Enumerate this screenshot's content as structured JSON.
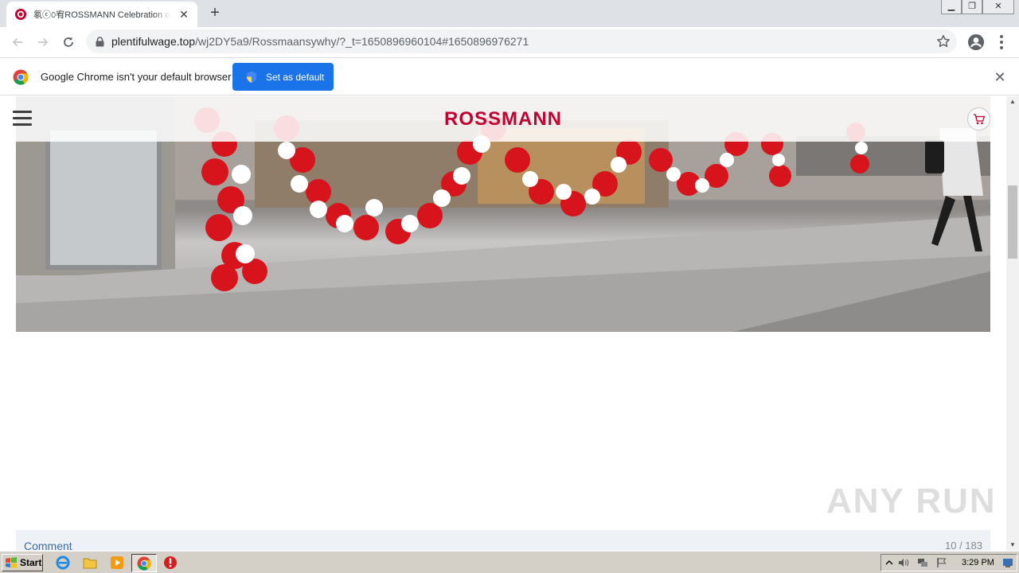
{
  "browser": {
    "tab": {
      "title": "氡ⓒ௦宥ROSSMANN Celebration of the"
    },
    "address": {
      "host": "plentifulwage.top",
      "path": "/wj2DY5a9/Rossmaansywhy/?_t=1650896960104#1650896976271"
    },
    "infobar": {
      "message": "Google Chrome isn't your default browser",
      "button_label": "Set as default"
    }
  },
  "page": {
    "brand": "ROSSMANN",
    "comment_label": "Comment",
    "counter": "10 / 183",
    "watermark": "ANY RUN"
  },
  "taskbar": {
    "start_label": "Start",
    "clock": "3:29 PM"
  },
  "colors": {
    "brand_red": "#c3002f",
    "chrome_blue": "#1a73e8",
    "tabstrip": "#dee1e6",
    "taskbar": "#d4d0c8"
  },
  "icons": {
    "tab_favicon": "rossmann-logo-icon",
    "back": "arrow-left-icon",
    "forward": "arrow-right-icon",
    "reload": "reload-icon",
    "lock": "lock-icon",
    "bookmark": "star-icon",
    "profile": "account-icon",
    "menu": "kebab-menu-icon",
    "infobar": "chrome-logo-icon",
    "shield": "shield-icon",
    "hamburger": "hamburger-menu-icon",
    "cart": "shopping-cart-icon"
  }
}
